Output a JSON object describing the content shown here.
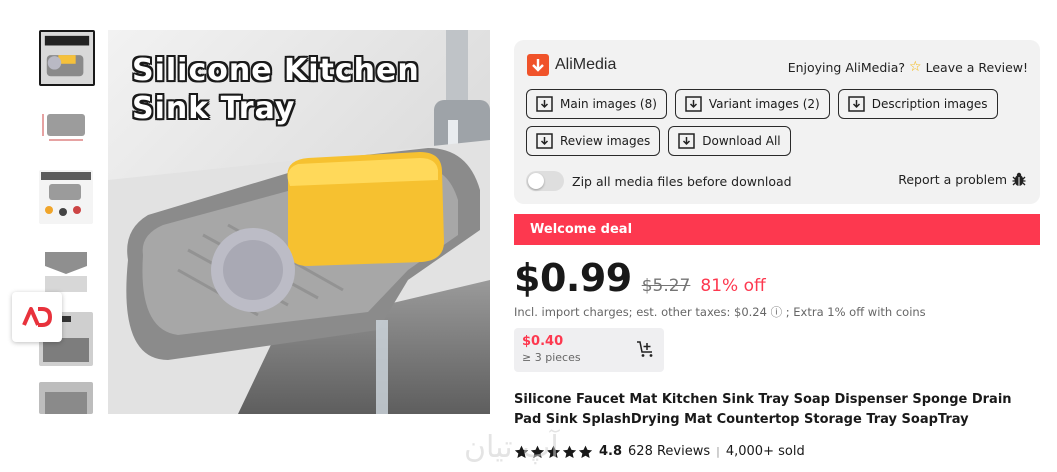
{
  "gallery": {
    "hero_title_line1": "Silicone Kitchen",
    "hero_title_line2": "Sink Tray",
    "thumbnails": [
      "thumb-1",
      "thumb-2",
      "thumb-3",
      "thumb-4",
      "thumb-5",
      "thumb-6"
    ]
  },
  "alimedia": {
    "brand": "AliMedia",
    "review_prompt": "Enjoying AliMedia?",
    "review_link": "Leave a Review!",
    "buttons_row1": [
      "Main images (8)",
      "Variant images (2)",
      "Description images"
    ],
    "buttons_row2": [
      "Review images",
      "Download All"
    ],
    "zip_label": "Zip all media files before download",
    "zip_enabled": false,
    "report_label": "Report a problem",
    "brand_color": "#f0532a"
  },
  "deal": {
    "label": "Welcome deal",
    "color": "#fd384f"
  },
  "pricing": {
    "price": "$0.99",
    "old_price": "$5.27",
    "discount": "81% off",
    "tax_note": "Incl. import charges; est. other taxes: $0.24 ⓘ ; Extra 1% off with coins",
    "tier_price": "$0.40",
    "tier_qty": "≥ 3 pieces"
  },
  "product": {
    "title": "Silicone Faucet Mat Kitchen Sink Tray Soap Dispenser Sponge Drain Pad Sink SplashDrying Mat Countertop Storage Tray SoapTray",
    "rating": "4.8",
    "stars": 5,
    "reviews": "628 Reviews",
    "sold": "4,000+ sold"
  },
  "watermark": "آپ تیان"
}
